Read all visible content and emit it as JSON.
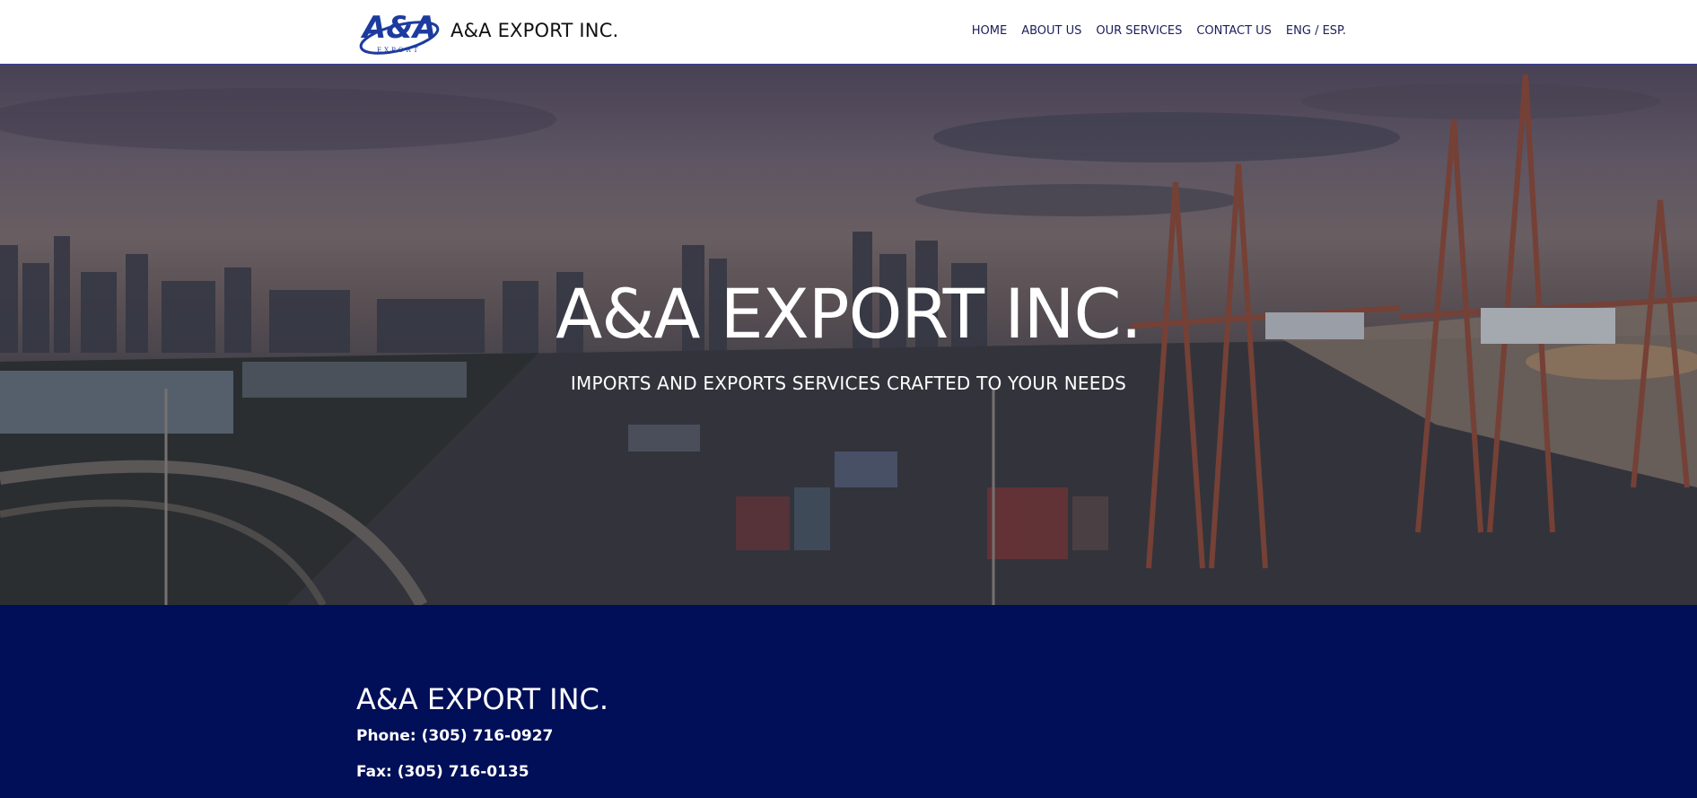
{
  "header": {
    "brand": "A&A EXPORT INC.",
    "logo_icon": "aa-export-logo",
    "nav": [
      {
        "label": "HOME"
      },
      {
        "label": "ABOUT US"
      },
      {
        "label": "OUR SERVICES"
      },
      {
        "label": "CONTACT US"
      },
      {
        "label": "ENG / ESP."
      }
    ],
    "colors": {
      "nav_text": "#1b1f5a",
      "border": "#3b3f86"
    }
  },
  "hero": {
    "title": "A&A EXPORT INC.",
    "subtitle": "IMPORTS AND EXPORTS SERVICES CRAFTED TO YOUR NEEDS",
    "background": "port-container-terminal-dusk-photo"
  },
  "contact": {
    "title": "A&A EXPORT INC.",
    "phone": "Phone: (305) 716-0927",
    "fax": "Fax: (305) 716-0135",
    "background_color": "#000f57"
  }
}
